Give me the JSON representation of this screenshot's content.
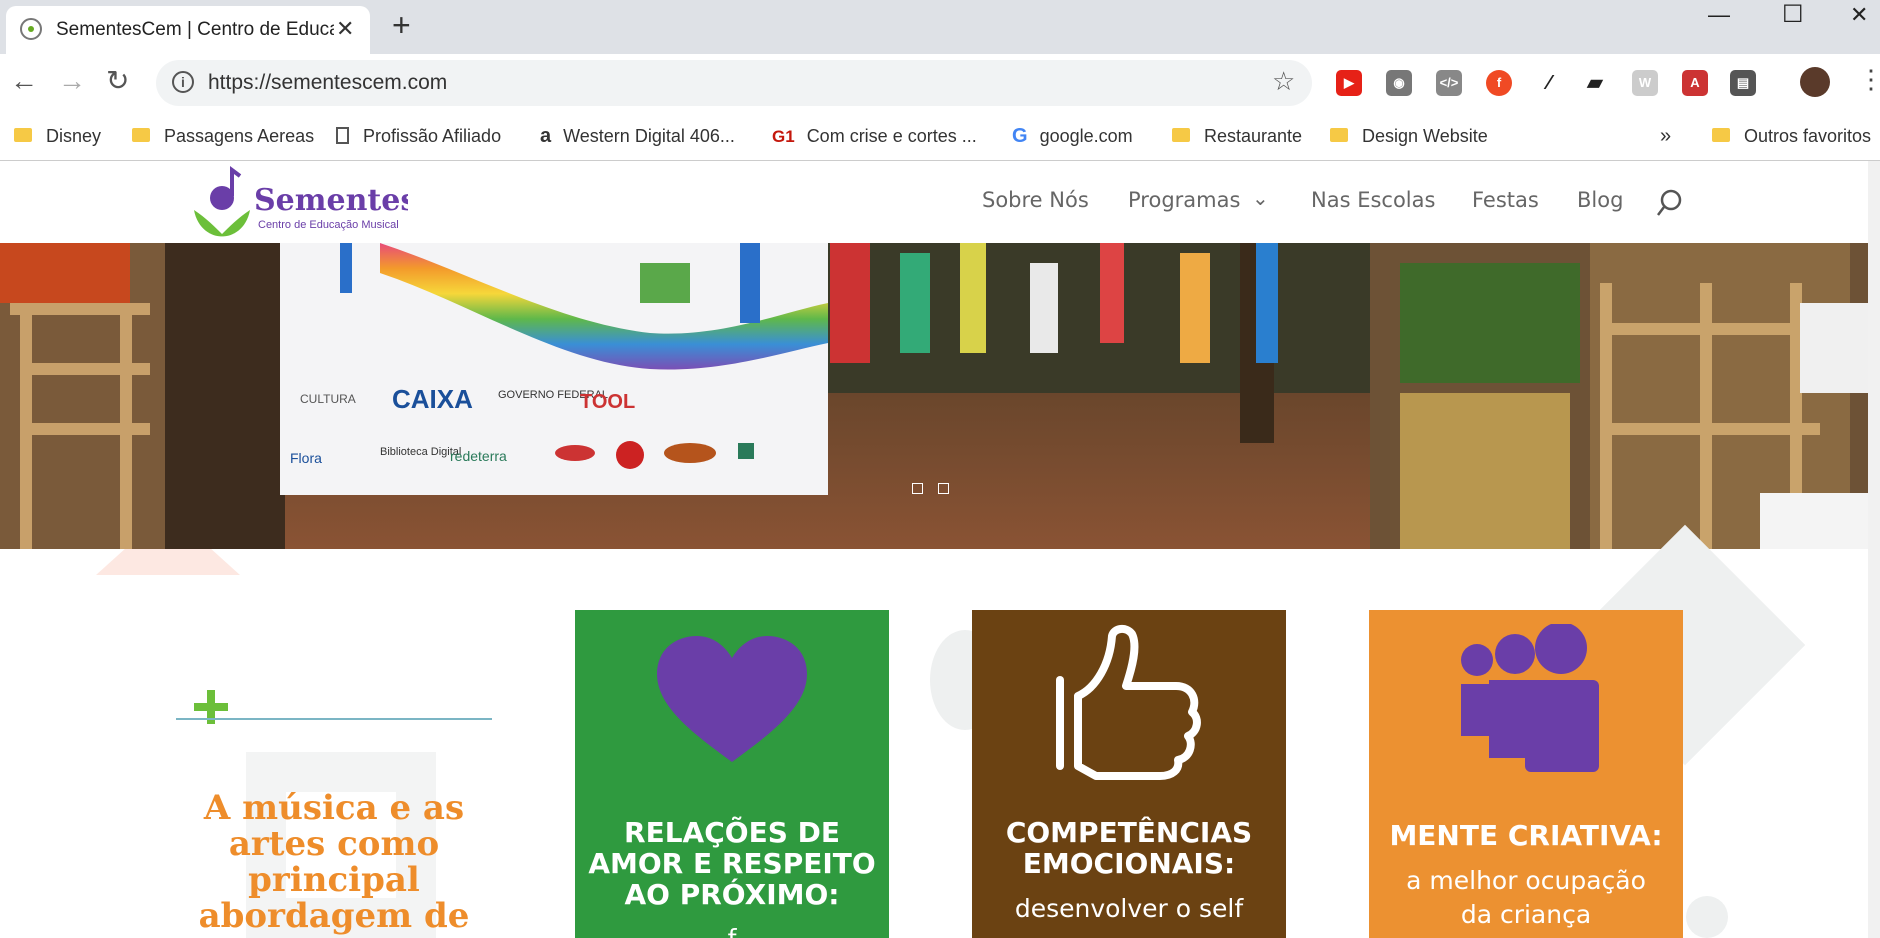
{
  "browser": {
    "tab_title": "SementesCem | Centro de Educa",
    "url": "https://sementescem.com",
    "bookmarks": [
      {
        "label": "Disney",
        "icon": "folder-icon"
      },
      {
        "label": "Passagens Aereas",
        "icon": "folder-icon"
      },
      {
        "label": "Profissão Afiliado",
        "icon": "page-icon"
      },
      {
        "label": "Western Digital 406...",
        "icon": "amazon-icon"
      },
      {
        "label": "Com crise e cortes ...",
        "icon": "g1-icon"
      },
      {
        "label": "google.com",
        "icon": "google-icon"
      },
      {
        "label": "Restaurante",
        "icon": "folder-icon"
      },
      {
        "label": "Design Website",
        "icon": "folder-icon"
      }
    ],
    "bookmarks_overflow": "»",
    "other_bookmarks": "Outros favoritos"
  },
  "site": {
    "logo_name": "Sementes",
    "logo_tagline": "Centro de Educação Musical",
    "nav": [
      "Sobre Nós",
      "Programas",
      "Nas Escolas",
      "Festas",
      "Blog"
    ],
    "hero": {
      "banner_logos": [
        "CULTURA",
        "CAIXA",
        "GOVERNO FEDERAL",
        "TOOL",
        "Flora",
        "Biblioteca Digital",
        "redeterra"
      ],
      "slide_count": 2
    },
    "headline": "A música e as artes como principal abordagem de",
    "cards": [
      {
        "title": "RELAÇÕES DE AMOR E RESPEITO AO PRÓXIMO:",
        "subtitle": "",
        "color": "#2f9a3f",
        "icon": "heart-icon"
      },
      {
        "title": "COMPETÊNCIAS EMOCIONAIS:",
        "subtitle": "desenvolver o self",
        "color": "#6b4212",
        "icon": "thumbs-up-icon"
      },
      {
        "title": "MENTE CRIATIVA:",
        "subtitle": "a melhor ocupação da criança",
        "color": "#ec9131",
        "icon": "people-group-icon"
      }
    ],
    "colors": {
      "purple": "#6a3ea8",
      "orange": "#ee8d2b",
      "green": "#2f9a3f",
      "brown": "#6b4212"
    }
  }
}
